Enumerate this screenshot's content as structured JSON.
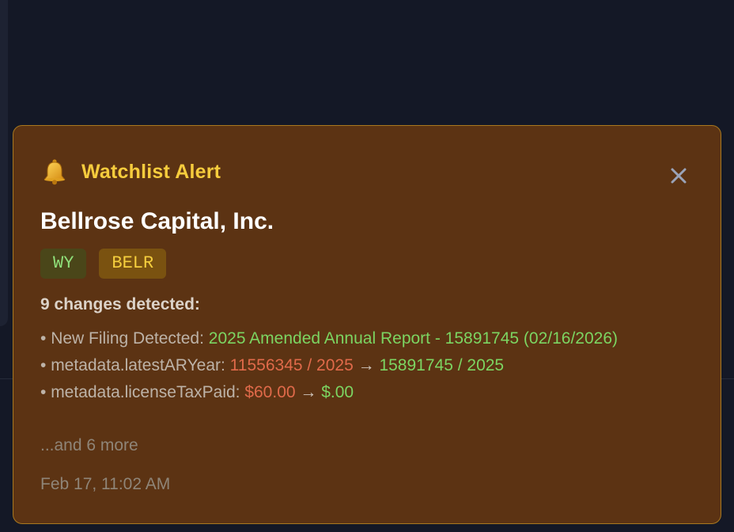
{
  "toast": {
    "icon": "bell-icon",
    "alert_label": "Watchlist Alert",
    "close_icon": "close-icon",
    "company_name": "Bellrose Capital, Inc.",
    "badges": {
      "state": "WY",
      "ticker": "BELR"
    },
    "changes_heading": "9 changes detected:",
    "changes": [
      {
        "bullet": "• ",
        "label": "New Filing Detected: ",
        "new_value": "2025 Amended Annual Report - 15891745 (02/16/2026)"
      },
      {
        "bullet": "• ",
        "label": "metadata.latestARYear: ",
        "old_value": "11556345 / 2025",
        "arrow": " → ",
        "new_value": "15891745 / 2025"
      },
      {
        "bullet": "• ",
        "label": "metadata.licenseTaxPaid: ",
        "old_value": "$60.00",
        "arrow": " → ",
        "new_value": "$.00"
      }
    ],
    "more_text": "...and 6 more",
    "timestamp": "Feb 17, 11:02 AM"
  },
  "colors": {
    "toast_bg": "#5c3313",
    "toast_border": "#a8781f",
    "alert_accent": "#f6cc3d",
    "old_value": "#e06a4a",
    "new_value": "#7cd562",
    "page_bg": "#141826"
  }
}
